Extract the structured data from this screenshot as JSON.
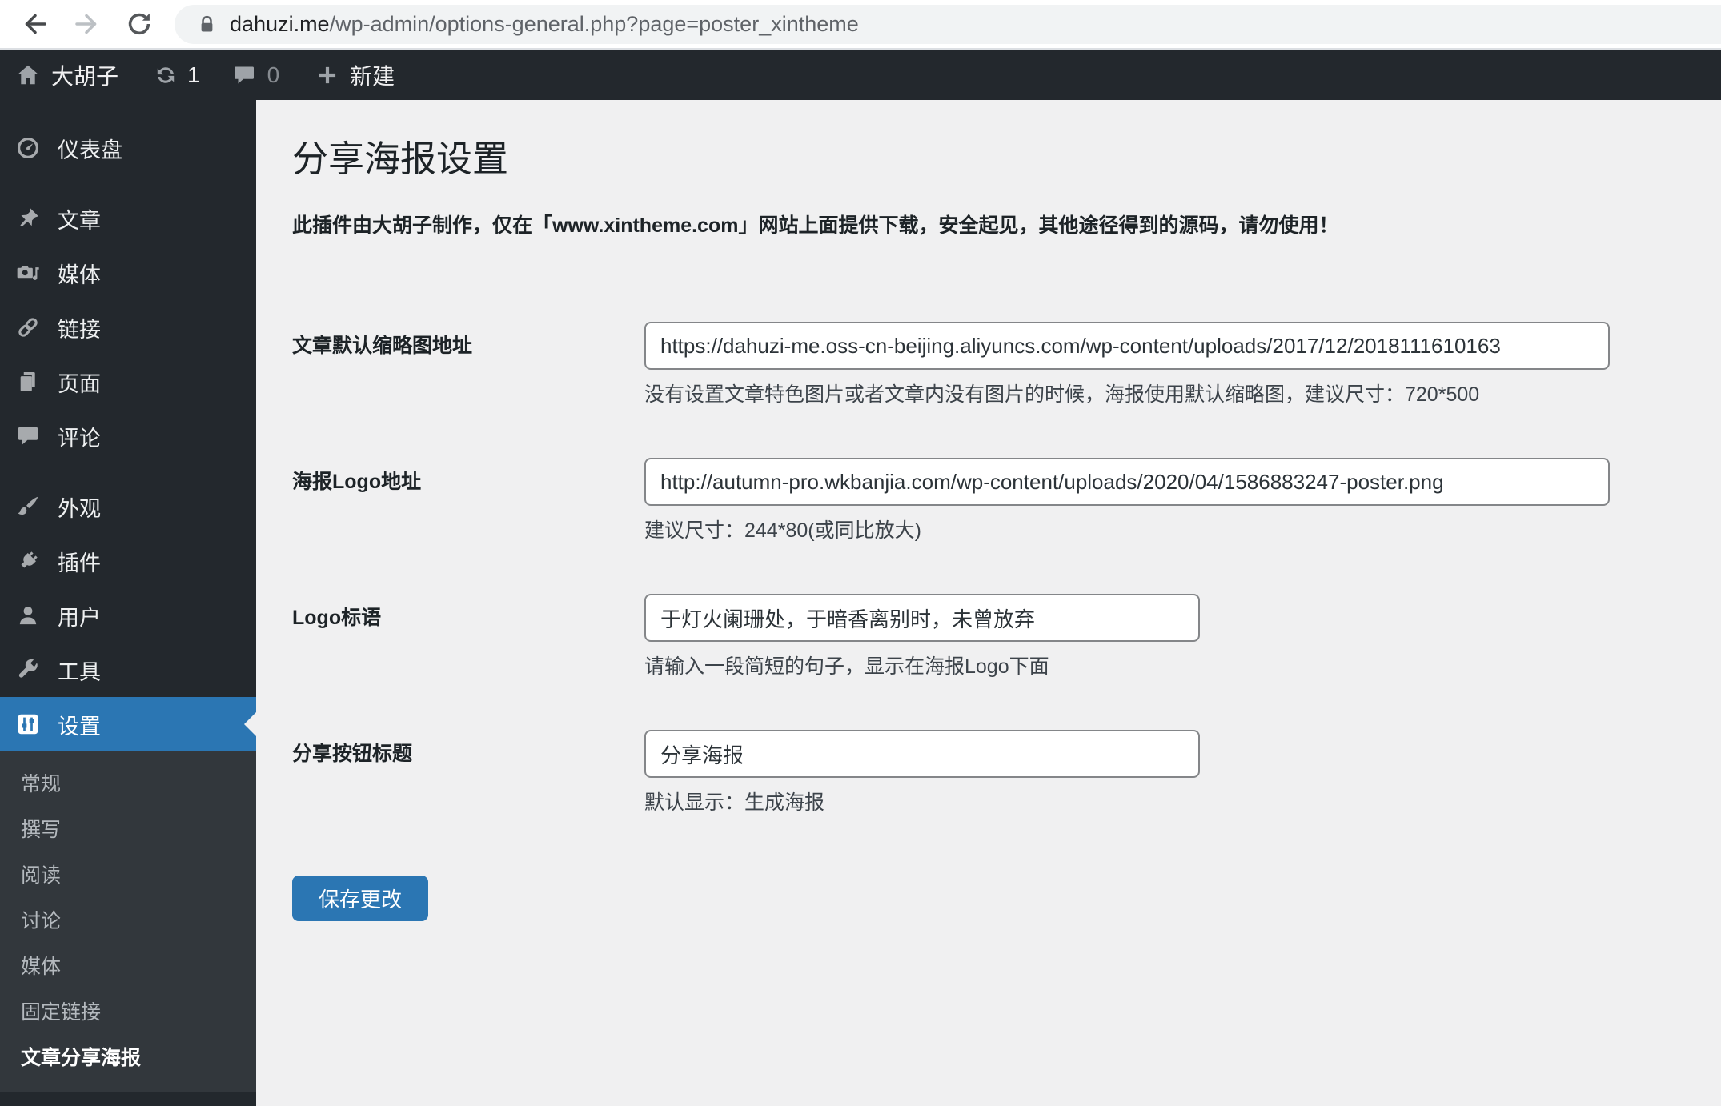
{
  "browser": {
    "url_domain": "dahuzi.me",
    "url_path": "/wp-admin/options-general.php?page=poster_xintheme"
  },
  "admin_bar": {
    "site_name": "大胡子",
    "update_count": "1",
    "comment_count": "0",
    "new_label": "新建"
  },
  "sidebar": {
    "items": [
      {
        "label": "仪表盘",
        "icon": "dashboard-icon"
      },
      {
        "label": "文章",
        "icon": "posts-icon"
      },
      {
        "label": "媒体",
        "icon": "media-icon"
      },
      {
        "label": "链接",
        "icon": "links-icon"
      },
      {
        "label": "页面",
        "icon": "pages-icon"
      },
      {
        "label": "评论",
        "icon": "comments-icon"
      },
      {
        "label": "外观",
        "icon": "appearance-icon"
      },
      {
        "label": "插件",
        "icon": "plugins-icon"
      },
      {
        "label": "用户",
        "icon": "users-icon"
      },
      {
        "label": "工具",
        "icon": "tools-icon"
      },
      {
        "label": "设置",
        "icon": "settings-icon",
        "current": true
      }
    ],
    "submenu": [
      {
        "label": "常规"
      },
      {
        "label": "撰写"
      },
      {
        "label": "阅读"
      },
      {
        "label": "讨论"
      },
      {
        "label": "媒体"
      },
      {
        "label": "固定链接"
      },
      {
        "label": "文章分享海报",
        "current": true
      }
    ]
  },
  "page": {
    "title": "分享海报设置",
    "notice": "此插件由大胡子制作，仅在「www.xintheme.com」网站上面提供下载，安全起见，其他途径得到的源码，请勿使用！",
    "fields": [
      {
        "label": "文章默认缩略图地址",
        "value": "https://dahuzi-me.oss-cn-beijing.aliyuncs.com/wp-content/uploads/2017/12/2018111610163",
        "help": "没有设置文章特色图片或者文章内没有图片的时候，海报使用默认缩略图，建议尺寸：720*500"
      },
      {
        "label": "海报Logo地址",
        "value": "http://autumn-pro.wkbanjia.com/wp-content/uploads/2020/04/1586883247-poster.png",
        "help": "建议尺寸：244*80(或同比放大)"
      },
      {
        "label": "Logo标语",
        "value": "于灯火阑珊处，于暗香离别时，未曾放弃",
        "help": "请输入一段简短的句子，显示在海报Logo下面"
      },
      {
        "label": "分享按钮标题",
        "value": "分享海报",
        "help": "默认显示：生成海报"
      }
    ],
    "save_label": "保存更改"
  },
  "colors": {
    "accent_blue": "#2b76b3",
    "menu_bg": "#23282d",
    "submenu_bg": "#32373c",
    "content_bg": "#f0f0f1"
  }
}
